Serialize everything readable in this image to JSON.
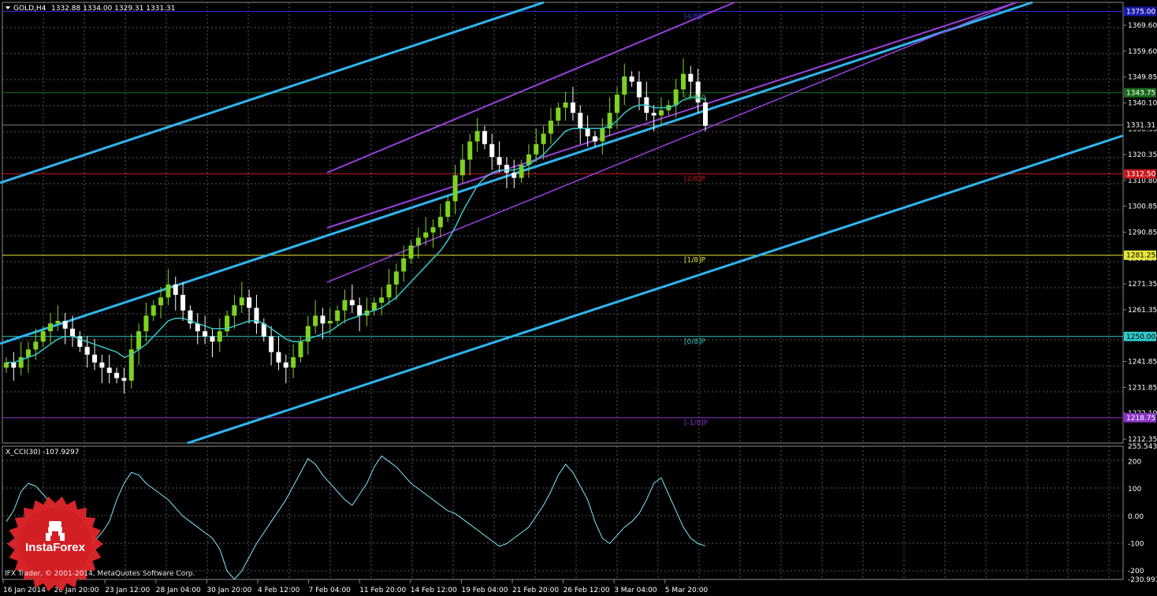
{
  "window": {
    "symbol_title": "GOLD,H4",
    "ohlc": "1332.88 1334.00 1329.31 1331.31",
    "indicator_title": "X_CCI(30) -107.9297",
    "copyright": "IFX Trader, © 2001-2014, MetaQuotes Software Corp.",
    "logo_text": "InstaForex"
  },
  "colors": {
    "background": "#000000",
    "grid": "#5a5a5a",
    "bull": "#7ed321",
    "bear": "#ffffff",
    "channel_light": "#2fb5f0",
    "channel_violet": "#9b3fdc",
    "ma": "#35c7c7",
    "cci": "#7fe8ff",
    "logo": "#e0262c"
  },
  "price_axis": {
    "labels": [
      "1369.60",
      "1359.60",
      "1349.85",
      "1340.10",
      "1330.35",
      "1320.35",
      "1310.80",
      "1300.85",
      "1290.85",
      "1281.25",
      "1271.35",
      "1261.35",
      "1251.60",
      "1241.85",
      "1231.85",
      "1222.10",
      "1212.35"
    ],
    "tags": [
      {
        "text": "1375.00",
        "color": "#1a1aa8",
        "value": 1375.0
      },
      {
        "text": "1343.75",
        "color": "#1a6b1a",
        "value": 1343.75
      },
      {
        "text": "1331.31",
        "color": "#000000",
        "value": 1331.31
      },
      {
        "text": "1312.50",
        "color": "#c8191e",
        "value": 1312.5
      },
      {
        "text": "1281.25",
        "color": "#e6e639",
        "value": 1281.25
      },
      {
        "text": "1250.00",
        "color": "#31c8c8",
        "value": 1250.0
      },
      {
        "text": "1218.75",
        "color": "#8a32c8",
        "value": 1218.75
      }
    ]
  },
  "murray_labels": [
    {
      "text": "[4/8]P",
      "color": "#3c3cd0",
      "value": 1375.0
    },
    {
      "text": "[3/8]P",
      "color": "#3aa83a",
      "value": 1343.75
    },
    {
      "text": "[2/8]P",
      "color": "#c8191e",
      "value": 1312.5
    },
    {
      "text": "[1/8]P",
      "color": "#e6e639",
      "value": 1281.25
    },
    {
      "text": "[0/8]P",
      "color": "#31c8c8",
      "value": 1250.0
    },
    {
      "text": "[-1/8]P",
      "color": "#8a32c8",
      "value": 1218.75
    }
  ],
  "cci_axis": {
    "labels": [
      "255.5434",
      "200",
      "100",
      "0.00",
      "-100",
      "-200",
      "-230.9914"
    ]
  },
  "date_axis": {
    "labels": [
      "16 Jan 2014",
      "20 Jan 20:00",
      "23 Jan 12:00",
      "28 Jan 04:00",
      "30 Jan 20:00",
      "4 Feb 12:00",
      "7 Feb 04:00",
      "11 Feb 20:00",
      "14 Feb 12:00",
      "19 Feb 04:00",
      "21 Feb 20:00",
      "26 Feb 12:00",
      "3 Mar 04:00",
      "5 Mar 20:00"
    ]
  },
  "chart_data": {
    "type": "candlestick",
    "timeframe": "H4",
    "ylim": [
      1209.0,
      1378.5
    ],
    "cci_ylim": [
      -230.9914,
      255.5434
    ],
    "grid": true,
    "closes": [
      1240,
      1238,
      1242,
      1245,
      1248,
      1252,
      1255,
      1256,
      1253,
      1250,
      1246,
      1243,
      1240,
      1238,
      1236,
      1234,
      1233,
      1245,
      1252,
      1258,
      1262,
      1265,
      1270,
      1266,
      1260,
      1255,
      1252,
      1250,
      1248,
      1252,
      1258,
      1262,
      1265,
      1261,
      1255,
      1250,
      1244,
      1240,
      1238,
      1242,
      1248,
      1254,
      1258,
      1255,
      1256,
      1260,
      1264,
      1262,
      1258,
      1260,
      1263,
      1265,
      1270,
      1275,
      1280,
      1285,
      1288,
      1290,
      1292,
      1296,
      1302,
      1312,
      1318,
      1325,
      1329,
      1324,
      1319,
      1316,
      1313,
      1311,
      1316,
      1320,
      1324,
      1328,
      1333,
      1338,
      1340,
      1336,
      1330,
      1327,
      1325,
      1330,
      1336,
      1343,
      1350,
      1348,
      1342,
      1336,
      1335,
      1337,
      1339,
      1345,
      1351,
      1348,
      1340,
      1331
    ],
    "ma": [
      1240,
      1240,
      1241,
      1242,
      1243,
      1245,
      1247,
      1249,
      1250,
      1250,
      1249,
      1248,
      1247,
      1246,
      1245,
      1244,
      1242,
      1243,
      1245,
      1247,
      1250,
      1253,
      1256,
      1257,
      1257,
      1256,
      1255,
      1254,
      1253,
      1253,
      1253,
      1254,
      1255,
      1256,
      1256,
      1255,
      1253,
      1251,
      1249,
      1248,
      1248,
      1249,
      1250,
      1251,
      1252,
      1254,
      1256,
      1257,
      1258,
      1259,
      1260,
      1261,
      1263,
      1265,
      1268,
      1271,
      1274,
      1277,
      1280,
      1283,
      1287,
      1292,
      1298,
      1303,
      1308,
      1311,
      1313,
      1314,
      1314,
      1314,
      1315,
      1316,
      1318,
      1320,
      1323,
      1326,
      1329,
      1330,
      1330,
      1330,
      1330,
      1330,
      1331,
      1333,
      1336,
      1338,
      1339,
      1339,
      1338,
      1338,
      1338,
      1339,
      1341,
      1342,
      1342,
      1341
    ],
    "cci": [
      -20,
      20,
      90,
      120,
      110,
      80,
      50,
      10,
      -40,
      -80,
      -110,
      -120,
      -90,
      -60,
      -20,
      60,
      120,
      160,
      150,
      120,
      100,
      80,
      60,
      30,
      0,
      -20,
      -40,
      -60,
      -80,
      -120,
      -200,
      -230,
      -200,
      -150,
      -100,
      -60,
      -20,
      20,
      60,
      110,
      160,
      210,
      190,
      150,
      120,
      90,
      60,
      40,
      80,
      120,
      180,
      220,
      200,
      180,
      150,
      120,
      100,
      80,
      60,
      40,
      20,
      10,
      -10,
      -30,
      -50,
      -70,
      -90,
      -110,
      -100,
      -80,
      -60,
      -40,
      0,
      40,
      90,
      150,
      190,
      160,
      110,
      60,
      -20,
      -80,
      -100,
      -70,
      -40,
      -20,
      10,
      60,
      120,
      140,
      80,
      20,
      -40,
      -80,
      -100,
      -108
    ]
  }
}
